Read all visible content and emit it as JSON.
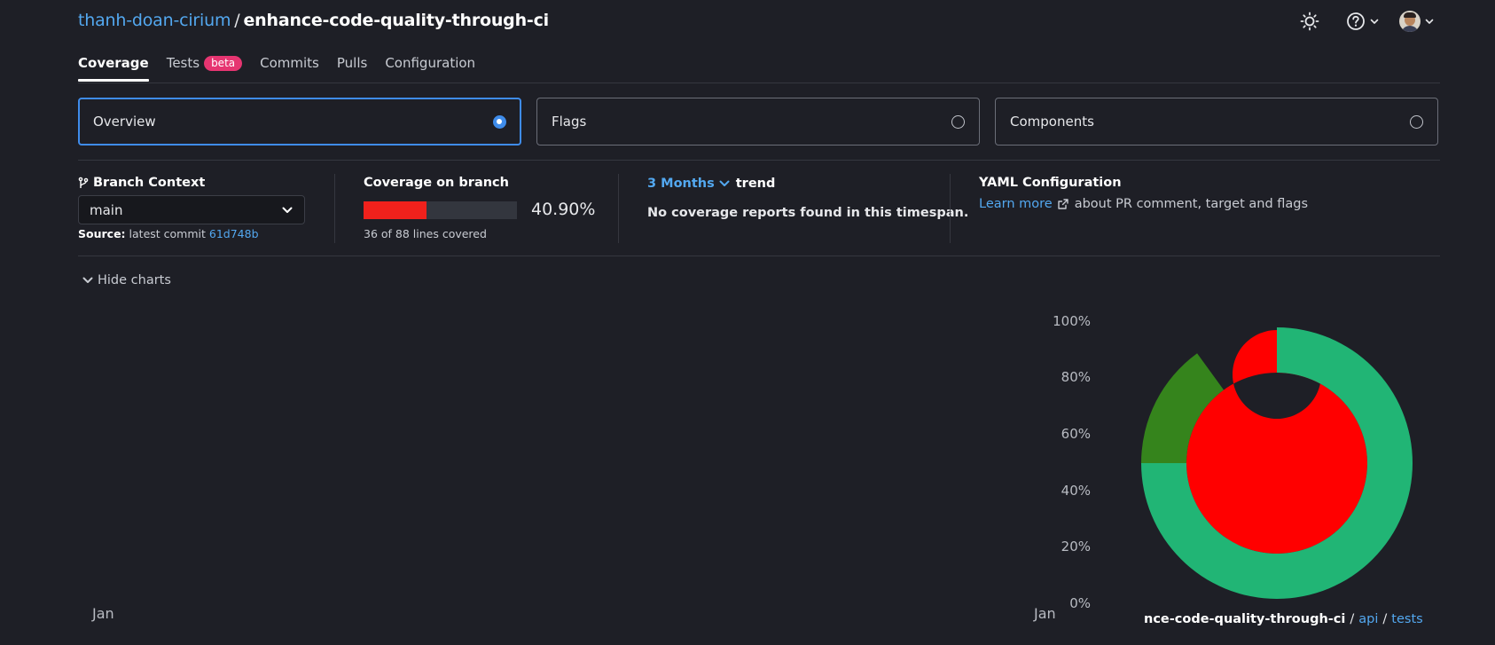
{
  "header": {
    "owner": "thanh-doan-cirium",
    "separator": "/",
    "repo": "enhance-code-quality-through-ci"
  },
  "icons": {
    "theme": "sun-icon",
    "help": "question-circle-icon",
    "avatar": "user-avatar"
  },
  "tabs": [
    {
      "label": "Coverage",
      "active": true
    },
    {
      "label": "Tests",
      "badge": "beta"
    },
    {
      "label": "Commits"
    },
    {
      "label": "Pulls"
    },
    {
      "label": "Configuration"
    }
  ],
  "views": [
    {
      "label": "Overview",
      "selected": true
    },
    {
      "label": "Flags",
      "selected": false
    },
    {
      "label": "Components",
      "selected": false
    }
  ],
  "branch_context": {
    "label": "Branch Context",
    "value": "main",
    "source_label": "Source:",
    "source_text": "latest commit",
    "commit": "61d748b"
  },
  "coverage": {
    "label": "Coverage on branch",
    "percent_text": "40.90%",
    "percent": 40.9,
    "lines_text": "36 of 88 lines covered",
    "bar_color": "#f0211c"
  },
  "trend": {
    "range": "3 Months",
    "word": "trend",
    "message": "No coverage reports found in this timespan."
  },
  "yaml": {
    "label": "YAML Configuration",
    "link": "Learn more",
    "text": "about PR comment, target and flags"
  },
  "charts_toggle": "Hide charts",
  "trend_chart": {
    "x_start": "Jan",
    "x_end": "Jan",
    "y_ticks": [
      "100%",
      "80%",
      "60%",
      "40%",
      "20%",
      "0%"
    ]
  },
  "sunburst": {
    "colors": {
      "high": "#21b575",
      "mid": "#35841c",
      "low": "#ff0000"
    },
    "breadcrumb": {
      "current": "nce-code-quality-through-ci",
      "sep": "/",
      "items": [
        "api",
        "tests"
      ]
    }
  },
  "chart_data": {
    "type": "sunburst",
    "rings": [
      {
        "name": "inner",
        "segments": [
          {
            "fraction": 1.0,
            "color": "#ff0000"
          }
        ]
      },
      {
        "name": "outer",
        "segments": [
          {
            "fraction": 0.75,
            "color": "#21b575"
          },
          {
            "fraction": 0.15,
            "color": "#35841c"
          }
        ]
      }
    ]
  }
}
